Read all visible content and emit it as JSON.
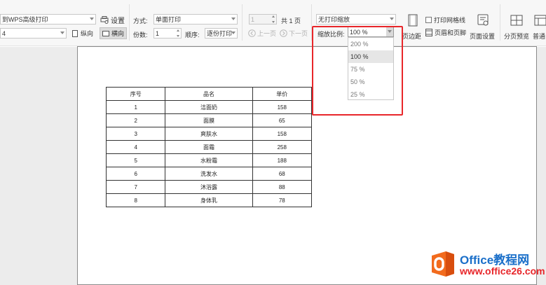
{
  "toolbar": {
    "printer_select": "到WPS高级打印",
    "settings_label": "设置",
    "paper_select": "4",
    "portrait_label": "纵向",
    "landscape_label": "横向",
    "method_label": "方式:",
    "method_value": "单面打印",
    "copies_label": "份数:",
    "copies_value": "1",
    "order_label": "顺序:",
    "order_value": "逐份打印",
    "page_value": "1",
    "total_pages": "共 1 页",
    "prev_page": "上一页",
    "next_page": "下一页",
    "scale_mode_value": "无打印缩放",
    "scale_ratio_label": "缩放比例:",
    "scale_ratio_value": "100 %",
    "print_gridlines": "打印网格线",
    "margins_label": "页边距",
    "header_footer_label": "页眉和页脚",
    "page_setup_label": "页面设置",
    "page_break_preview": "分页预览",
    "normal_view": "普通"
  },
  "scale_dropdown": {
    "options": [
      "200 %",
      "100 %",
      "75 %",
      "50 %",
      "25 %"
    ],
    "selected": "100 %"
  },
  "table": {
    "headers": [
      "序号",
      "品名",
      "单价"
    ],
    "rows": [
      [
        "1",
        "洁面奶",
        "158"
      ],
      [
        "2",
        "面膜",
        "65"
      ],
      [
        "3",
        "爽肤水",
        "158"
      ],
      [
        "4",
        "面霜",
        "258"
      ],
      [
        "5",
        "水粉霜",
        "188"
      ],
      [
        "6",
        "洗发水",
        "68"
      ],
      [
        "7",
        "沐浴露",
        "88"
      ],
      [
        "8",
        "身体乳",
        "78"
      ]
    ]
  },
  "watermark": {
    "title": "Office教程网",
    "url": "www.office26.com"
  },
  "colors": {
    "highlight": "#e8262a",
    "watermark_blue": "#1a6fc9",
    "watermark_orange": "#f26b1d"
  }
}
